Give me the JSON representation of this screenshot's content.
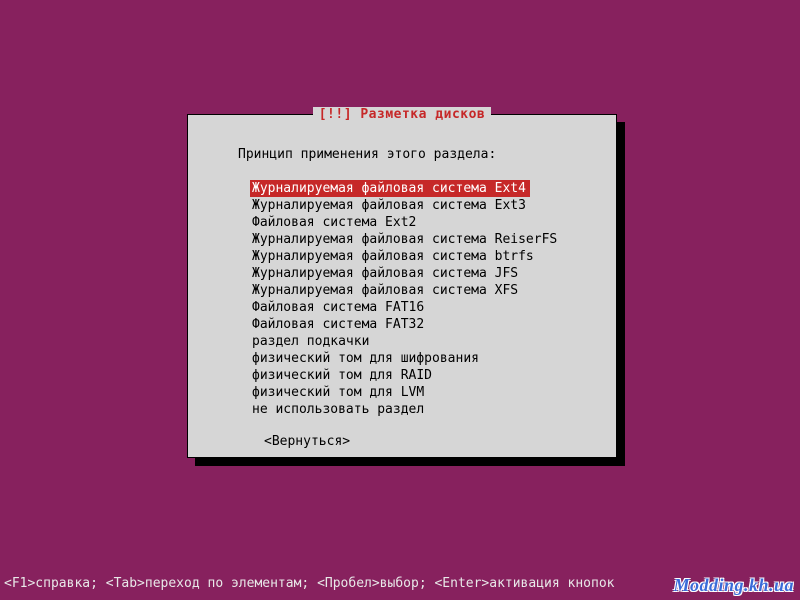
{
  "dialog": {
    "title": "[!!] Разметка дисков",
    "prompt": "Принцип применения этого раздела:",
    "menu": [
      "Журналируемая файловая система Ext4",
      "Журналируемая файловая система Ext3",
      "Файловая система Ext2",
      "Журналируемая файловая система ReiserFS",
      "Журналируемая файловая система btrfs",
      "Журналируемая файловая система JFS",
      "Журналируемая файловая система XFS",
      "Файловая система FAT16",
      "Файловая система FAT32",
      "раздел подкачки",
      "физический том для шифрования",
      "физический том для RAID",
      "физический том для LVM",
      "не использовать раздел"
    ],
    "selected_index": 0,
    "back_label": "<Вернуться>"
  },
  "help_bar": "<F1>справка; <Tab>переход по элементам; <Пробел>выбор; <Enter>активация кнопок",
  "watermark": "Modding.kh.ua",
  "colors": {
    "background": "#87215e",
    "dialog_bg": "#d6d6d6",
    "highlight": "#c62828"
  }
}
